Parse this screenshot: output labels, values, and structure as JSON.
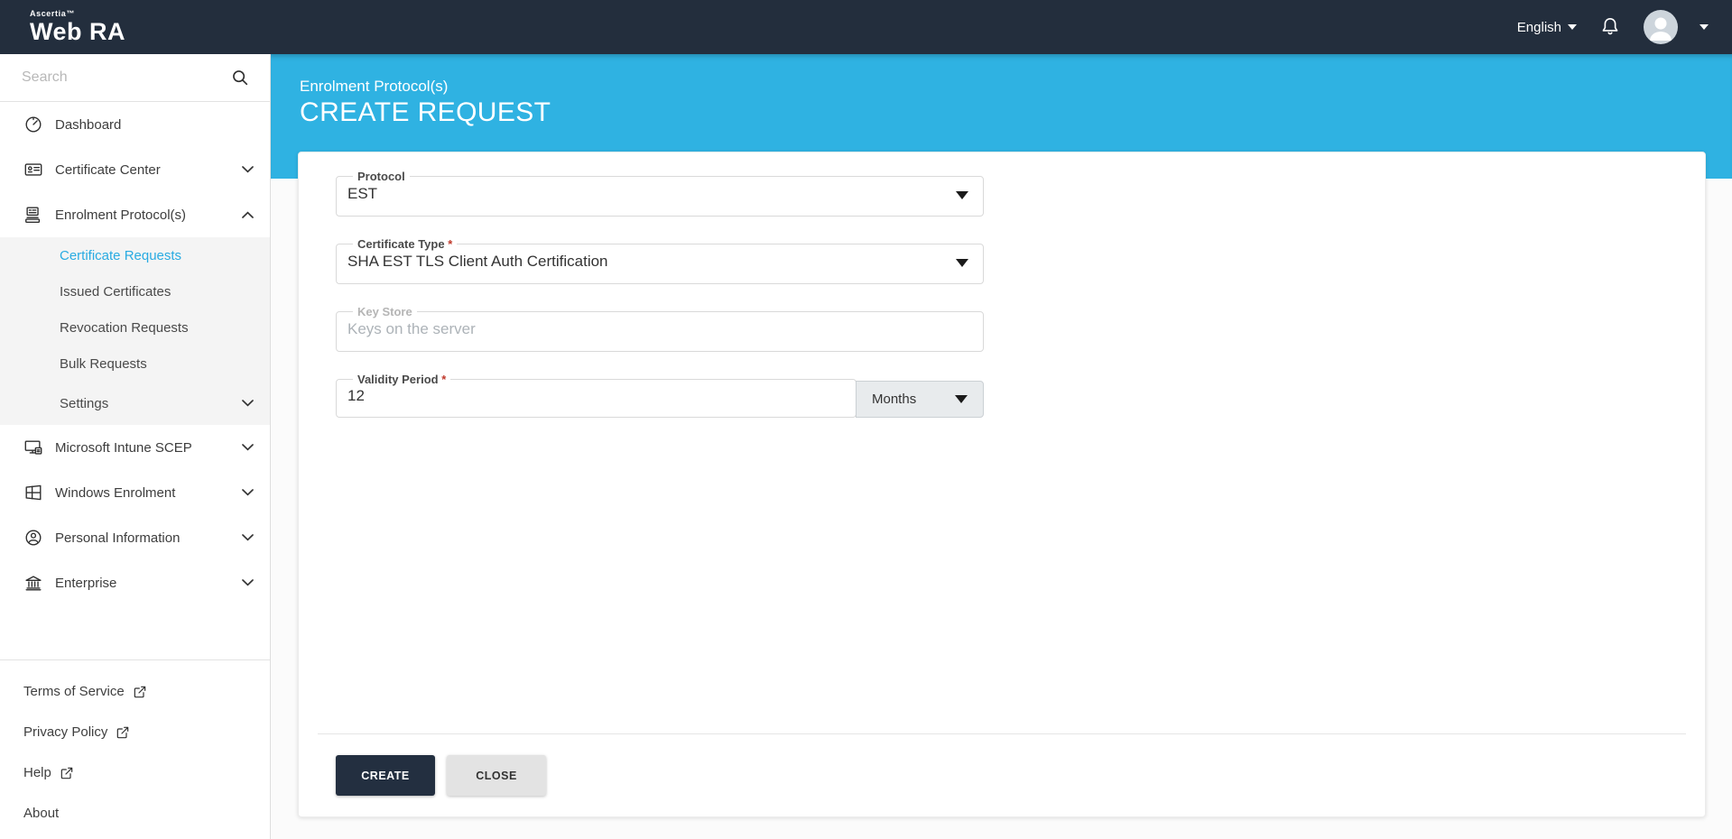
{
  "topbar": {
    "brand": "Ascertia™",
    "product": "Web RA",
    "language": "English",
    "icons": {
      "notifications": "bell-icon",
      "profile": "avatar-icon",
      "language_arrow": "chevron-down-icon"
    }
  },
  "sidebar": {
    "search_placeholder": "Search",
    "items": [
      {
        "label": "Dashboard",
        "icon": "gauge-icon"
      },
      {
        "label": "Certificate Center",
        "icon": "certificate-icon",
        "chevron": "down"
      },
      {
        "label": "Enrolment Protocol(s)",
        "icon": "enrolment-device-icon",
        "chevron": "up",
        "expanded": true,
        "children": [
          {
            "label": "Certificate Requests",
            "active": true
          },
          {
            "label": "Issued Certificates"
          },
          {
            "label": "Revocation Requests"
          },
          {
            "label": "Bulk Requests"
          },
          {
            "label": "Settings",
            "chevron": "down"
          }
        ]
      },
      {
        "label": "Microsoft Intune SCEP",
        "icon": "monitor-icon",
        "chevron": "down"
      },
      {
        "label": "Windows Enrolment",
        "icon": "windows-icon",
        "chevron": "down"
      },
      {
        "label": "Personal Information",
        "icon": "person-circle-icon",
        "chevron": "down"
      },
      {
        "label": "Enterprise",
        "icon": "bank-icon",
        "chevron": "down"
      }
    ],
    "footer_links": [
      {
        "label": "Terms of Service",
        "external": true
      },
      {
        "label": "Privacy Policy",
        "external": true
      },
      {
        "label": "Help",
        "external": true
      },
      {
        "label": "About",
        "external": false
      }
    ]
  },
  "header": {
    "breadcrumb": "Enrolment Protocol(s)",
    "title": "CREATE REQUEST"
  },
  "form": {
    "required_marker": "*",
    "protocol": {
      "label": "Protocol",
      "value": "EST",
      "type": "dropdown"
    },
    "certificate_type": {
      "label": "Certificate Type",
      "value": "SHA EST TLS Client Auth Certification",
      "required": true,
      "type": "dropdown"
    },
    "key_store": {
      "label": "Key Store",
      "value": "Keys on the server",
      "disabled": true
    },
    "validity_period": {
      "label": "Validity Period",
      "value": "12",
      "required": true,
      "unit": "Months"
    }
  },
  "actions": {
    "create_label": "CREATE",
    "close_label": "CLOSE"
  },
  "colors": {
    "topbar_navy": "#232e3d",
    "header_blue": "#2fb2e2",
    "active_link_blue": "#29abe2",
    "required_red": "#c0392b",
    "create_button": "#232f40",
    "close_button": "#e3e3e3"
  }
}
